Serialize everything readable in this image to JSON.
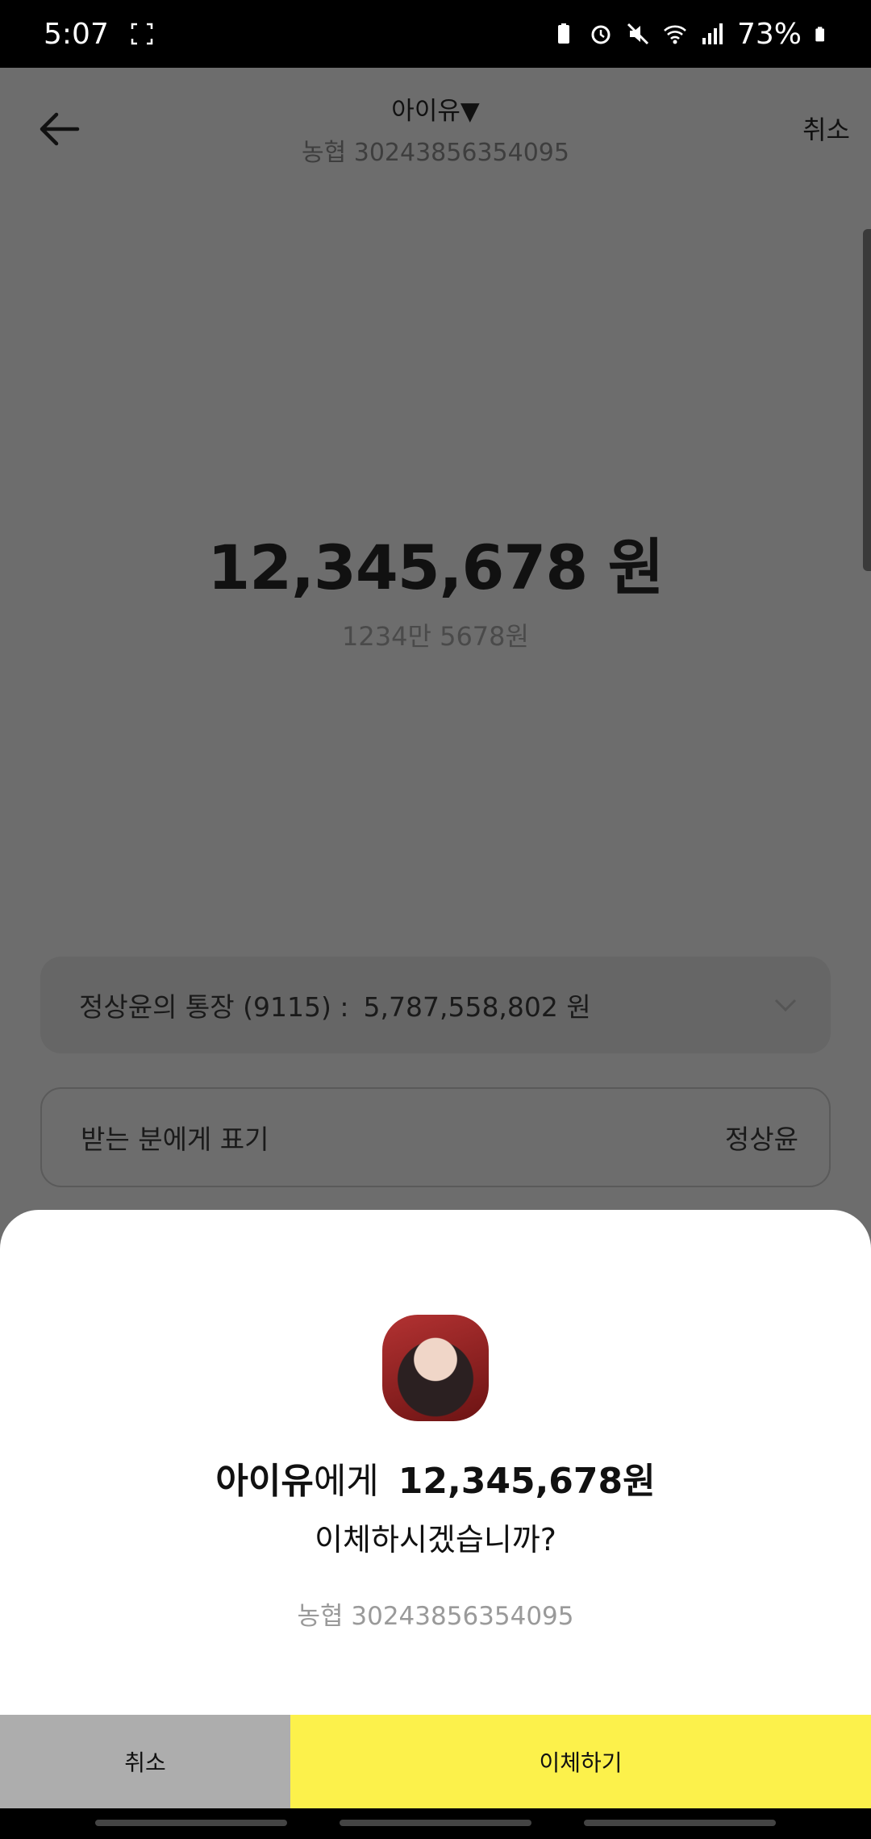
{
  "status_bar": {
    "time": "5:07",
    "battery": "73%",
    "icons": [
      "screenshot-icon",
      "battery-saver-icon",
      "alarm-icon",
      "mute-icon",
      "wifi-icon",
      "signal-icon",
      "battery-icon"
    ]
  },
  "header": {
    "recipient_name": "아이유▼",
    "recipient_account": "농협 30243856354095",
    "cancel_label": "취소"
  },
  "transfer": {
    "amount": "12,345,678 원",
    "amount_korean": "1234만 5678원"
  },
  "from_account": {
    "label": "정상윤의 통장 (9115) :",
    "balance": "5,787,558,802 원"
  },
  "memo": {
    "label": "받는 분에게 표기",
    "value": "정상윤"
  },
  "confirm_sheet": {
    "recipient": "아이유",
    "particle": "에게",
    "amount": "12,345,678원",
    "question": "이체하시겠습니까?",
    "account": "농협 30243856354095",
    "cancel_label": "취소",
    "confirm_label": "이체하기"
  },
  "colors": {
    "overlay": "#6d6d6d",
    "confirm_button": "#fcf14b",
    "cancel_button": "#adadad"
  }
}
